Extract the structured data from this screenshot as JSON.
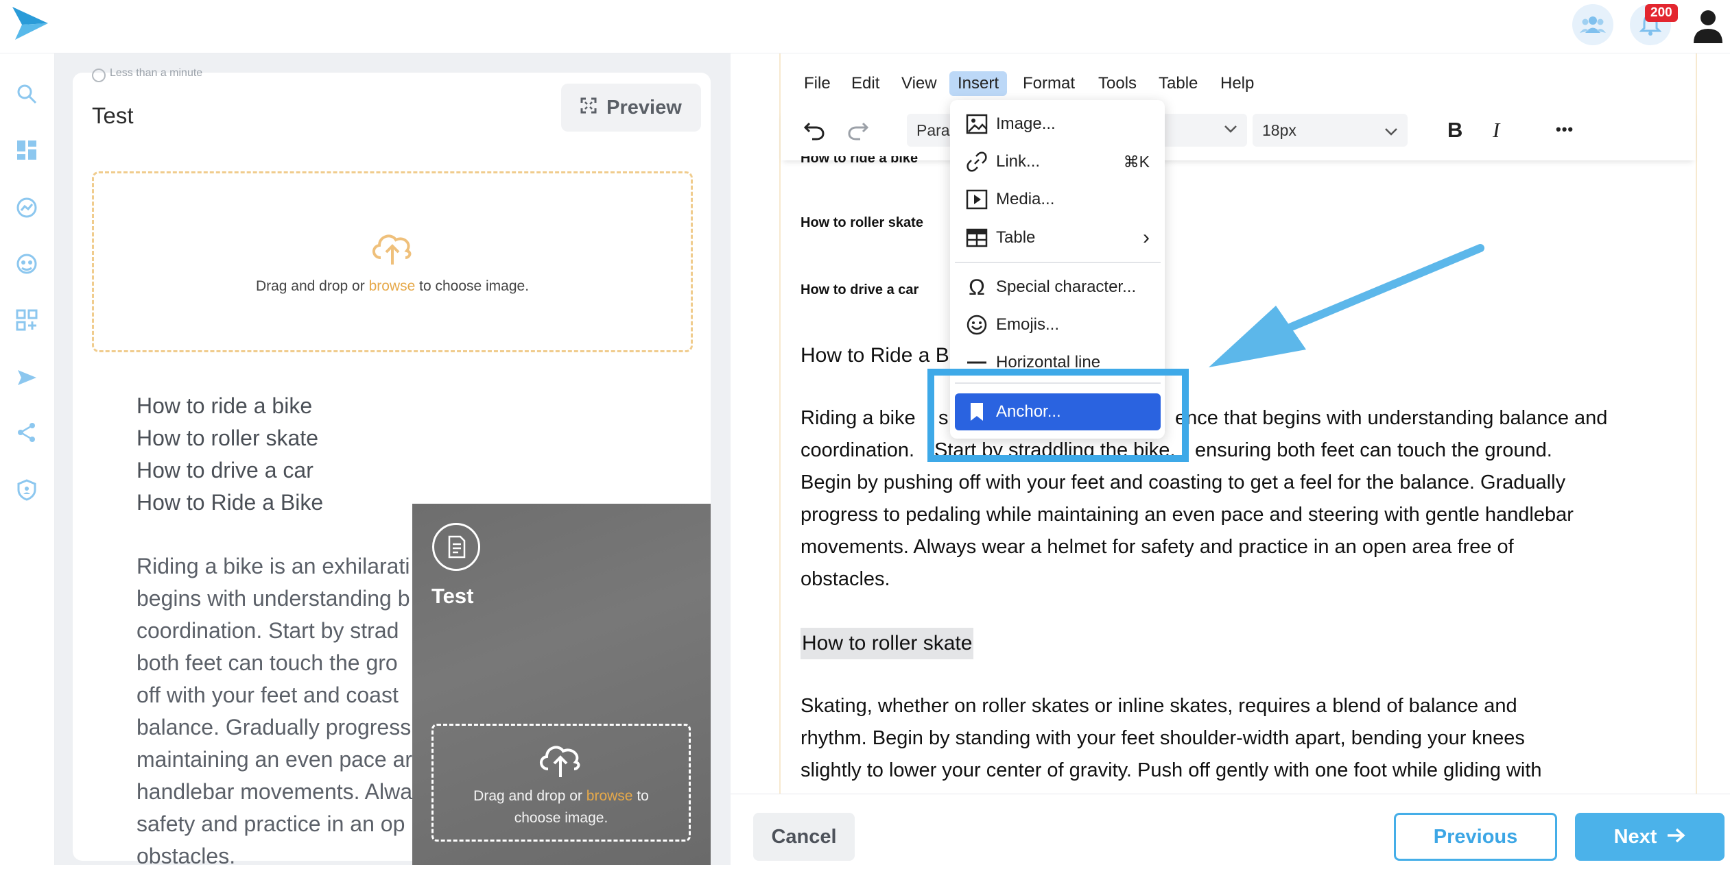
{
  "topbar": {
    "notification_count": "200",
    "icons": [
      "logo-icon",
      "team-icon",
      "bell-icon",
      "user-icon"
    ]
  },
  "sidebar": {
    "icons": [
      "search-icon",
      "dashboard-icon",
      "analytics-icon",
      "support-icon",
      "apps-icon",
      "send-icon",
      "share-icon",
      "shield-icon"
    ]
  },
  "left_card": {
    "meta": "Less than a minute",
    "title": "Test",
    "preview_label": "Preview",
    "drop_prefix": "Drag and drop or",
    "drop_link": "browse",
    "drop_suffix": "to choose image.",
    "toc": [
      "How to ride a bike",
      "How to roller skate",
      "How to drive a car",
      "How to Ride a Bike"
    ],
    "paragraph": [
      "Riding a bike is an exhilarati",
      "begins with understanding b",
      "coordination. Start by strad",
      "both feet can touch the gro",
      "off with your feet and coast",
      "balance. Gradually progress",
      "maintaining an even pace ar",
      "handlebar movements. Alwa",
      "safety and practice in an op",
      "obstacles."
    ]
  },
  "overlay": {
    "title": "Test",
    "drop_prefix": "Drag and drop or",
    "drop_link": "browse",
    "drop_mid": "to",
    "drop_line2": "choose image."
  },
  "editor": {
    "menubar": [
      "File",
      "Edit",
      "View",
      "Insert",
      "Format",
      "Tools",
      "Table",
      "Help"
    ],
    "block_format": "Para",
    "font_size": "18px",
    "bold_label": "B",
    "italic_label": "I",
    "more_label": "•••",
    "toc": [
      "How to ride a bike",
      "How to roller skate",
      "How to drive a car"
    ],
    "heading1": "How to Ride a B",
    "p1_lines": [
      "Riding a bike",
      "coordination.",
      "Begin by pushing off with your feet and coasting to get a feel for the balance. Gradually",
      "progress to pedaling while maintaining an even pace and steering with gentle handlebar",
      "movements. Always wear a helmet for safety and practice in an open area free of",
      "obstacles."
    ],
    "p1_right_1": "ence that begins with understanding balance and",
    "p1_right_2": "ensuring both feet can touch the ground.",
    "p1_mid_s": "s",
    "p1_mid_2": "Start by straddling the bike,",
    "heading2": "How to roller skate",
    "p2_lines": [
      "Skating, whether on roller skates or inline skates, requires a blend of balance and",
      "rhythm. Begin by standing with your feet shoulder-width apart, bending your knees",
      "slightly to lower your center of gravity. Push off gently with one foot while gliding with"
    ]
  },
  "insert_menu": {
    "items": [
      {
        "label": "Image...",
        "icon": "image-icon",
        "shortcut": ""
      },
      {
        "label": "Link...",
        "icon": "link-icon",
        "shortcut": "⌘K"
      },
      {
        "label": "Media...",
        "icon": "media-icon",
        "shortcut": ""
      },
      {
        "label": "Table",
        "icon": "table-icon",
        "shortcut": "›"
      },
      {
        "label": "Special character...",
        "icon": "omega-icon",
        "shortcut": ""
      },
      {
        "label": "Emojis...",
        "icon": "emoji-icon",
        "shortcut": ""
      },
      {
        "label": "Horizontal line",
        "icon": "horizontal-line-icon",
        "shortcut": ""
      }
    ],
    "anchor_label": "Anchor..."
  },
  "actions": {
    "cancel": "Cancel",
    "previous": "Previous",
    "next": "Next"
  },
  "colors": {
    "accent": "#4bb2ea",
    "highlight": "#3ea9e8",
    "menu_active": "#2a63e0",
    "browse": "#e6a94a",
    "badge": "#e3262f"
  }
}
